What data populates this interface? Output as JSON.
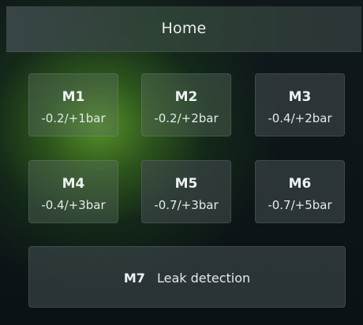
{
  "header": {
    "title": "Home"
  },
  "modules": [
    {
      "name": "M1",
      "range": "-0.2/+1bar"
    },
    {
      "name": "M2",
      "range": "-0.2/+2bar"
    },
    {
      "name": "M3",
      "range": "-0.4/+2bar"
    },
    {
      "name": "M4",
      "range": "-0.4/+3bar"
    },
    {
      "name": "M5",
      "range": "-0.7/+3bar"
    },
    {
      "name": "M6",
      "range": "-0.7/+5bar"
    }
  ],
  "leak": {
    "name": "M7",
    "label": "Leak detection"
  },
  "colors": {
    "accent_glow": "#4f8f28",
    "background": "#0d1417",
    "text": "#eef2f2"
  }
}
